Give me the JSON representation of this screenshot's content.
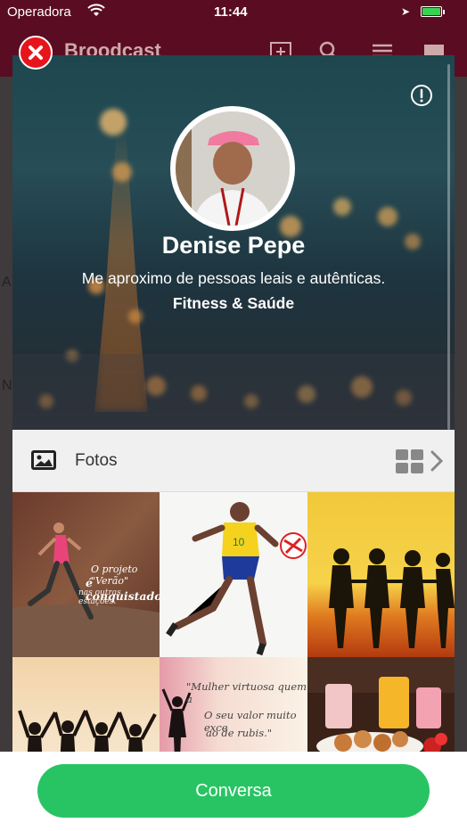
{
  "status_bar": {
    "carrier": "Operadora",
    "time": "11:44"
  },
  "app_bar": {
    "title": "Broodcast"
  },
  "profile": {
    "name": "Denise Pepe",
    "bio": "Me aproximo de pessoas leais e autênticas.",
    "category": "Fitness & Saúde"
  },
  "photos": {
    "label": "Fotos",
    "items": [
      {
        "caption_1": "O projeto \"Verão\"",
        "caption_2": "é conquistado",
        "caption_3": "nas outras estações."
      },
      {
        "caption_1": "",
        "caption_2": "",
        "caption_3": ""
      },
      {
        "caption_1": "",
        "caption_2": "",
        "caption_3": ""
      },
      {
        "caption_1": "",
        "caption_2": "",
        "caption_3": ""
      },
      {
        "caption_1": "\"Mulher virtuosa quem a",
        "caption_2": "O seu valor muito exce",
        "caption_3": "ao de rubis.\""
      },
      {
        "caption_1": "",
        "caption_2": "",
        "caption_3": ""
      }
    ]
  },
  "footer": {
    "cta_label": "Conversa"
  },
  "colors": {
    "brand": "#5a0d22",
    "close": "#e8141c",
    "cta": "#28c464"
  }
}
